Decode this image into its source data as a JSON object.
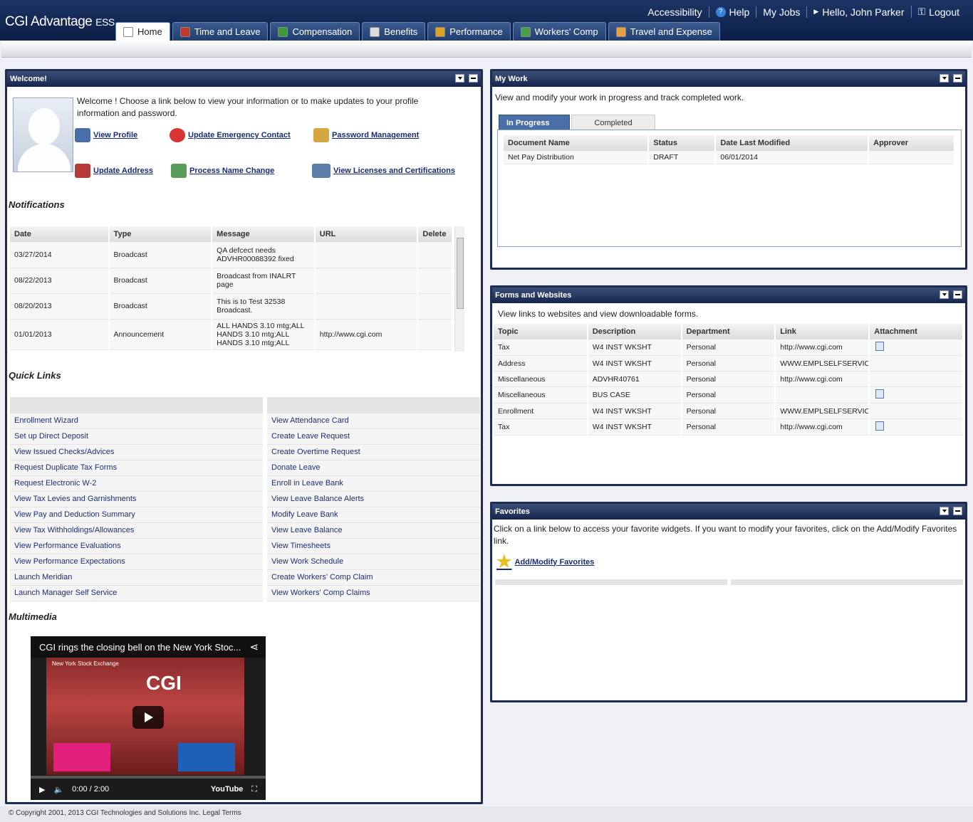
{
  "app": {
    "name": "CGI Advantage",
    "suffix": "ESS"
  },
  "util": {
    "accessibility": "Accessibility",
    "help": "Help",
    "myjobs": "My Jobs",
    "hello": "Hello, John Parker",
    "logout": "Logout"
  },
  "tabs": [
    {
      "label": "Home",
      "color": "#ffffff"
    },
    {
      "label": "Time and Leave",
      "color": "#c0392b"
    },
    {
      "label": "Compensation",
      "color": "#3a9b3a"
    },
    {
      "label": "Benefits",
      "color": "#dcdcdc"
    },
    {
      "label": "Performance",
      "color": "#e0a020"
    },
    {
      "label": "Workers' Comp",
      "color": "#4aa04a"
    },
    {
      "label": "Travel and Expense",
      "color": "#e8a040"
    }
  ],
  "welcome": {
    "title": "Welcome!",
    "intro": "Welcome ! Choose a link below to view your information or to make updates to your profile information and password.",
    "links": {
      "view_profile": "View Profile",
      "update_emergency": "Update Emergency Contact",
      "password": "Password Management",
      "update_address": "Update Address",
      "name_change": "Process Name Change",
      "licenses": "View Licenses and Certifications"
    }
  },
  "notifications": {
    "heading": "Notifications",
    "columns": [
      "Date",
      "Type",
      "Message",
      "URL",
      "Delete"
    ],
    "rows": [
      {
        "date": "03/27/2014",
        "type": "Broadcast",
        "message": "QA defcect needs ADVHR00088392 fixed",
        "url": ""
      },
      {
        "date": "08/22/2013",
        "type": "Broadcast",
        "message": "Broadcast from INALRT page",
        "url": ""
      },
      {
        "date": "08/20/2013",
        "type": "Broadcast",
        "message": "This is to Test 32538 Broadcast.",
        "url": ""
      },
      {
        "date": "01/01/2013",
        "type": "Announcement",
        "message": "ALL HANDS 3.10 mtg;ALL HANDS 3.10 mtg;ALL HANDS 3.10 mtg;ALL",
        "url": "http://www.cgi.com"
      }
    ]
  },
  "quicklinks": {
    "heading": "Quick Links",
    "left": [
      "Enrollment Wizard",
      "Set up Direct Deposit",
      "View Issued Checks/Advices",
      "Request Duplicate Tax Forms",
      "Request Electronic W-2",
      "View Tax Levies and Garnishments",
      "View Pay and Deduction Summary",
      "View Tax Withholdings/Allowances",
      "View Performance Evaluations",
      "View Performance Expectations",
      "Launch Meridian",
      "Launch Manager Self Service"
    ],
    "right": [
      "View Attendance Card",
      "Create Leave Request",
      "Create Overtime Request",
      "Donate Leave",
      "Enroll in Leave Bank",
      "View Leave Balance Alerts",
      "Modify Leave Bank",
      "View Leave Balance",
      "View Timesheets",
      "View Work Schedule",
      "Create Workers' Comp Claim",
      "View Workers' Comp Claims"
    ]
  },
  "multimedia": {
    "heading": "Multimedia",
    "video_title": "CGI rings the closing bell on the New York Stoc...",
    "time": "0:00",
    "duration": "2:00",
    "caption": "New York Stock Exchange"
  },
  "mywork": {
    "title": "My Work",
    "intro": "View and modify your work in progress and track completed work.",
    "tabs": [
      "In Progress",
      "Completed"
    ],
    "columns": [
      "Document Name",
      "Status",
      "Date Last Modified",
      "Approver"
    ],
    "rows": [
      {
        "doc": "Net Pay Distribution",
        "status": "DRAFT",
        "date": "06/01/2014",
        "approver": ""
      }
    ]
  },
  "forms": {
    "title": "Forms and Websites",
    "intro": "View links to websites and view downloadable forms.",
    "columns": [
      "Topic",
      "Description",
      "Department",
      "Link",
      "Attachment"
    ],
    "rows": [
      {
        "topic": "Tax",
        "desc": "W4 INST WKSHT",
        "dept": "Personal",
        "link": "http://www.cgi.com",
        "att": true
      },
      {
        "topic": "Address",
        "desc": "W4 INST WKSHT",
        "dept": "Personal",
        "link": "WWW.EMPLSELFSERVICE",
        "att": false
      },
      {
        "topic": "Miscellaneous",
        "desc": "ADVHR40761",
        "dept": "Personal",
        "link": "http://www.cgi.com",
        "att": false
      },
      {
        "topic": "Miscellaneous",
        "desc": "BUS CASE",
        "dept": "Personal",
        "link": "",
        "att": true
      },
      {
        "topic": "Enrollment",
        "desc": "W4 INST WKSHT",
        "dept": "Personal",
        "link": "WWW.EMPLSELFSERVICE",
        "att": false
      },
      {
        "topic": "Tax",
        "desc": "W4 INST WKSHT",
        "dept": "Personal",
        "link": "http://www.cgi.com",
        "att": true
      }
    ]
  },
  "favorites": {
    "title": "Favorites",
    "intro": "Click on a link below to access your favorite widgets. If you want to modify your favorites, click on the Add/Modify Favorites link.",
    "link": "Add/Modify Favorites"
  },
  "footer": {
    "copyright": "© Copyright 2001, 2013 CGI Technologies and Solutions Inc.",
    "legal": "Legal Terms"
  }
}
